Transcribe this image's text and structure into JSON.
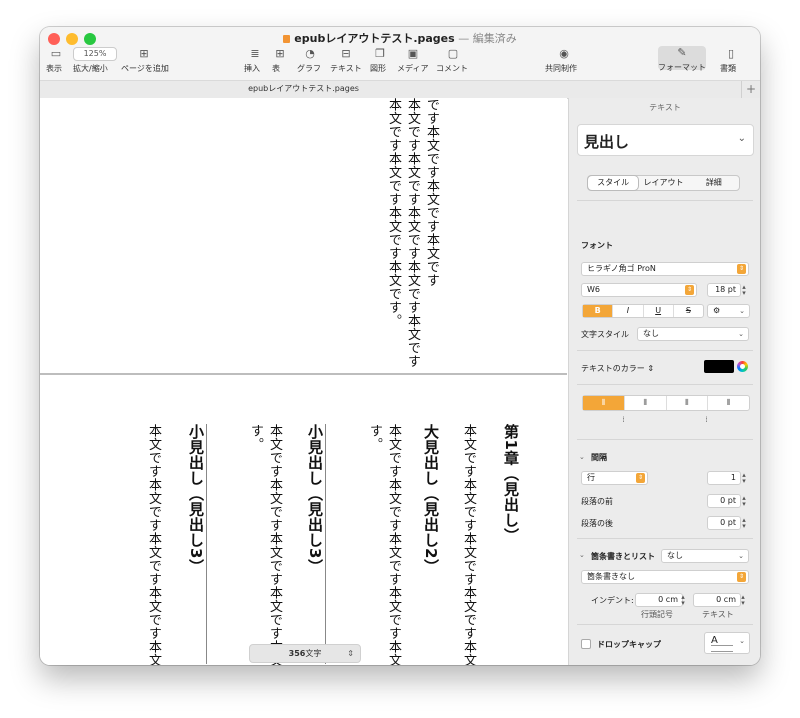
{
  "window": {
    "doc_name": "epubレイアウトテスト.pages",
    "separator": "—",
    "status": "編集済み"
  },
  "toolbar": {
    "view_label": "表示",
    "zoom_value": "125%",
    "zoom_label": "拡大/縮小",
    "add_page_label": "ページを追加",
    "insert_label": "挿入",
    "table_label": "表",
    "chart_label": "グラフ",
    "text_label": "テキスト",
    "shape_label": "図形",
    "media_label": "メディア",
    "comment_label": "コメント",
    "collab_label": "共同制作",
    "format_label": "フォーマット",
    "document_label": "書類"
  },
  "tab": {
    "title": "epubレイアウトテスト.pages",
    "add": "+"
  },
  "page1": {
    "lines": [
      "です本文です本文です本文です",
      "本文です本文です本文です本文です本文です",
      "本文です本文です本文です本文です。"
    ]
  },
  "page2": {
    "chapter_heading": "第1章（見出し）",
    "col_a": "本文です本文です本文です本文です本文です",
    "h2": "大見出し（見出し2）",
    "col_b1": "本文です本文です本文です本文です本文です",
    "col_b2": "す。",
    "h3a": "小見出し（見出し3）",
    "col_c1": "本文です本文です本文です本文です本文です",
    "col_c2": "す。",
    "h3b": "小見出し（見出し3）",
    "col_d": "本文です本文です本文です本文です本文です"
  },
  "word_count": {
    "value": "356",
    "unit": "文字"
  },
  "inspector": {
    "title": "テキスト",
    "paragraph_style": "見出し",
    "tabs": [
      "スタイル",
      "レイアウト",
      "詳細"
    ],
    "font_section": "フォント",
    "font_family": "ヒラギノ角ゴ ProN",
    "font_weight": "W6",
    "font_size": "18 pt",
    "fmt_buttons": [
      "B",
      "I",
      "U",
      "S"
    ],
    "char_style_label": "文字スタイル",
    "char_style_value": "なし",
    "text_color_label": "テキストのカラー",
    "text_color": "#000000",
    "accent_color": "#f3a638",
    "spacing_section": "間隔",
    "spacing_mode": "行",
    "spacing_value": "1",
    "before_label": "段落の前",
    "before_value": "0 pt",
    "after_label": "段落の後",
    "after_value": "0 pt",
    "bullets_label": "箇条書きとリスト",
    "bullets_value": "なし",
    "bullets_type": "箇条書きなし",
    "indent_label": "インデント:",
    "indent_bullet": "0 cm",
    "indent_text": "0 cm",
    "indent_bullet_caption": "行頭記号",
    "indent_text_caption": "テキスト",
    "dropcap_label": "ドロップキャップ"
  }
}
